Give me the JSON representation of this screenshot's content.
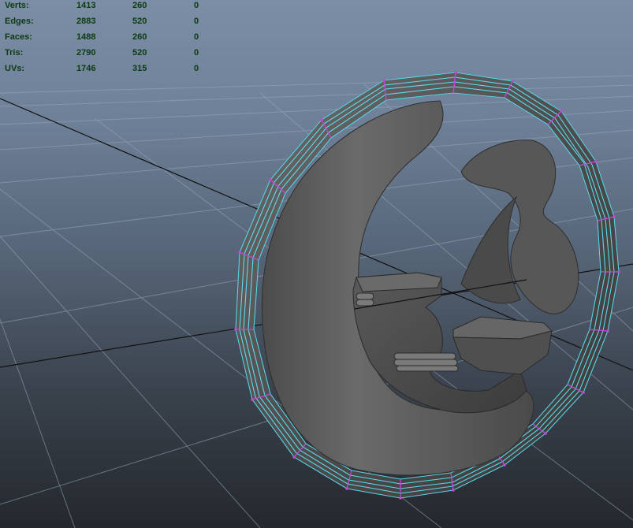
{
  "viewport": {
    "hud": {
      "rows": [
        {
          "label": "Verts:",
          "values": [
            "1413",
            "260",
            "0"
          ]
        },
        {
          "label": "Edges:",
          "values": [
            "2883",
            "520",
            "0"
          ]
        },
        {
          "label": "Faces:",
          "values": [
            "1488",
            "260",
            "0"
          ]
        },
        {
          "label": "Tris:",
          "values": [
            "2790",
            "520",
            "0"
          ]
        },
        {
          "label": "UVs:",
          "values": [
            "1746",
            "315",
            "0"
          ]
        }
      ]
    },
    "colors": {
      "hud_text": "#0d3a10",
      "grid_line": "#9aa8b8",
      "axis_line": "#111111",
      "mesh_fill": "#5b5b5b",
      "selection_edge": "#5fe8ff",
      "selection_vertex": "#c04ad8"
    }
  }
}
